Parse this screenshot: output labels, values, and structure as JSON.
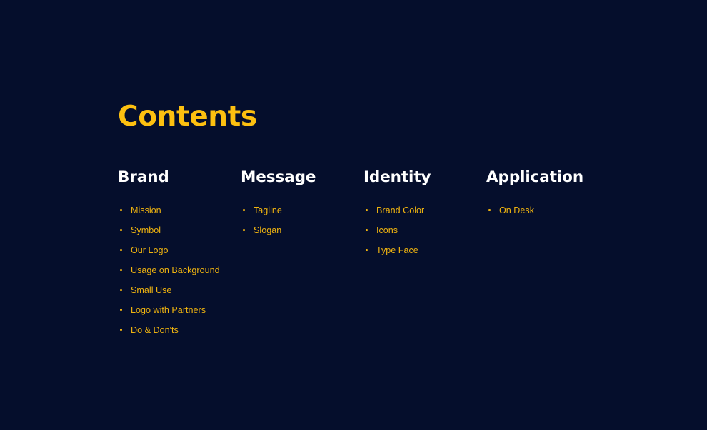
{
  "slide": {
    "title": "Contents",
    "background_color": "#050E2C",
    "accent_color": "#FDC010",
    "list_color": "#EFB310",
    "heading_color": "#FFFFFF",
    "rule_color": "#9A7314"
  },
  "columns": [
    {
      "title": "Brand",
      "items": [
        "Mission",
        "Symbol",
        "Our Logo",
        "Usage on Background",
        "Small Use",
        "Logo with Partners",
        "Do & Don'ts"
      ]
    },
    {
      "title": "Message",
      "items": [
        "Tagline",
        "Slogan"
      ]
    },
    {
      "title": "Identity",
      "items": [
        "Brand Color",
        "Icons",
        "Type Face"
      ]
    },
    {
      "title": "Application",
      "items": [
        "On Desk"
      ]
    }
  ]
}
